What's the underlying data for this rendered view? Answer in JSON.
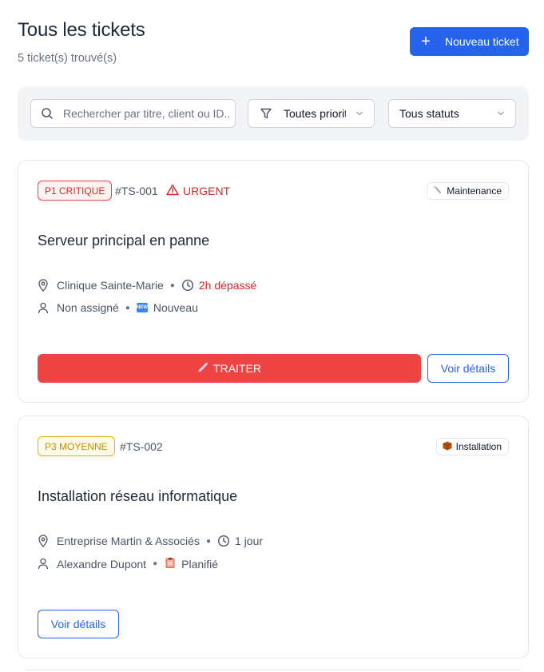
{
  "header": {
    "title": "Tous les tickets",
    "subtitle": "5 ticket(s) trouvé(s)",
    "new_button": {
      "icon": "plus-icon",
      "label": "Nouveau ticket"
    }
  },
  "filters": {
    "search": {
      "icon": "search-icon",
      "placeholder": "Rechercher par titre, client ou ID..."
    },
    "priority_select": {
      "icon": "filter-icon",
      "value": "Toutes priorités"
    },
    "status_select": {
      "value": "Tous statuts"
    }
  },
  "tickets": [
    {
      "priority_label": "P1 CRITIQUE",
      "id": "#TS-001",
      "urgent_label": "URGENT",
      "type": {
        "icon": "wrench-icon",
        "label": "Maintenance"
      },
      "title": "Serveur principal en panne",
      "client": "Clinique Sainte-Marie",
      "time": "2h dépassé",
      "assignee": "Non assigné",
      "status": {
        "icon": "new-icon",
        "label": "Nouveau"
      },
      "treat_label": "TRAITER",
      "details_label": "Voir détails"
    },
    {
      "priority_label": "P3 MOYENNE",
      "id": "#TS-002",
      "type": {
        "icon": "package-icon",
        "label": "Installation"
      },
      "title": "Installation réseau informatique",
      "client": "Entreprise Martin & Associés",
      "time": "1 jour",
      "assignee": "Alexandre Dupont",
      "status": {
        "icon": "clipboard-icon",
        "label": "Planifié"
      },
      "details_label": "Voir détails"
    }
  ],
  "colors": {
    "primary": "#2563eb",
    "danger": "#ef4444",
    "warning": "#eab308"
  }
}
